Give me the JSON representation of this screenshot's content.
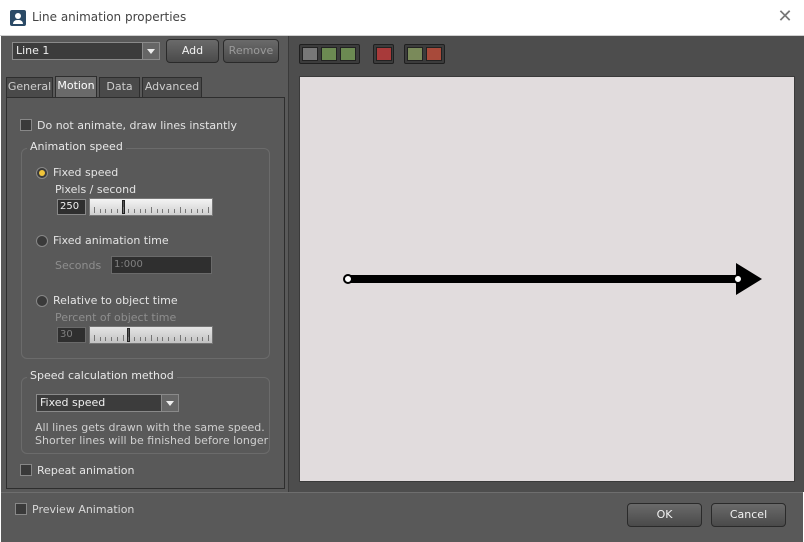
{
  "window": {
    "title": "Line animation properties",
    "app_icon": "user-icon",
    "close_icon": "close-icon"
  },
  "line_selector": {
    "value": "Line 1",
    "add_label": "Add",
    "remove_label": "Remove"
  },
  "tabs": [
    {
      "label": "General",
      "active": false
    },
    {
      "label": "Motion",
      "active": true
    },
    {
      "label": "Data",
      "active": false
    },
    {
      "label": "Advanced",
      "active": false
    }
  ],
  "motion": {
    "no_animate_label": "Do not animate, draw lines instantly",
    "no_animate_checked": false,
    "animation_speed": {
      "title": "Animation speed",
      "fixed_speed": {
        "label": "Fixed speed",
        "selected": true,
        "unit_label": "Pixels / second",
        "value": "250",
        "slider_fraction": 0.25
      },
      "fixed_time": {
        "label": "Fixed animation time",
        "selected": false,
        "unit_label": "Seconds",
        "value": "1:000"
      },
      "relative_time": {
        "label": "Relative to object time",
        "selected": false,
        "unit_label": "Percent of object time",
        "value": "30",
        "slider_fraction": 0.3
      }
    },
    "speed_calc": {
      "title": "Speed calculation method",
      "value": "Fixed speed",
      "description_line1": "All lines gets drawn with the same speed.",
      "description_line2": "Shorter lines will be finished before longer"
    },
    "repeat_label": "Repeat animation",
    "repeat_checked": false
  },
  "preview": {
    "canvas_color": "#e1dcdd",
    "line_color": "#000000",
    "toolbar_icons": [
      "select-point-icon",
      "add-point-icon",
      "move-point-icon",
      "delete-point-icon",
      "image-icon",
      "image-remove-icon"
    ]
  },
  "footer": {
    "preview_label": "Preview Animation",
    "preview_checked": false,
    "ok_label": "OK",
    "cancel_label": "Cancel"
  },
  "colors": {
    "dialog_bg": "#595959",
    "accent_radio": "#f0c43a"
  }
}
